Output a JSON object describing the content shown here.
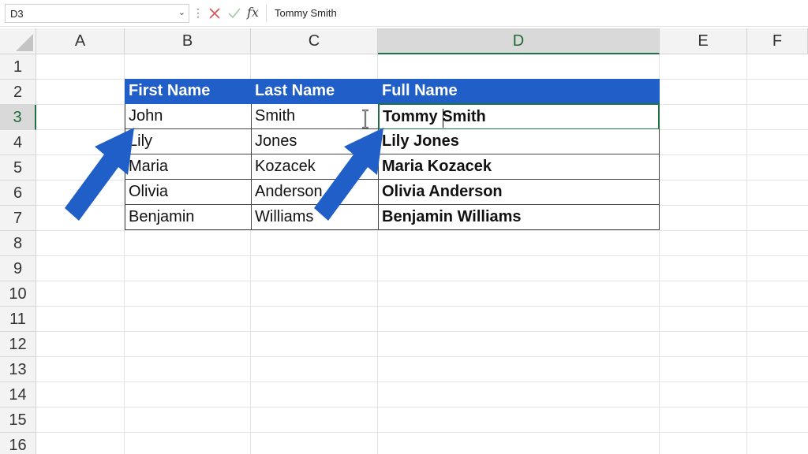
{
  "formula_bar": {
    "name_box": "D3",
    "formula": "Tommy Smith",
    "fx_label": "fx",
    "cancel_icon": "x-icon",
    "enter_icon": "check-icon"
  },
  "columns": [
    "A",
    "B",
    "C",
    "D",
    "E",
    "F"
  ],
  "rows": [
    "1",
    "2",
    "3",
    "4",
    "5",
    "6",
    "7",
    "8",
    "9",
    "10",
    "11",
    "12",
    "13",
    "14",
    "15",
    "16"
  ],
  "active_cell": {
    "column": "D",
    "row": "3"
  },
  "table": {
    "headers": [
      "First Name",
      "Last Name",
      "Full Name"
    ],
    "rows": [
      [
        "John",
        "Smith",
        "Tommy Smith"
      ],
      [
        "Lily",
        "Jones",
        "Lily  Jones"
      ],
      [
        "Maria",
        "Kozacek",
        "Maria Kozacek"
      ],
      [
        "Olivia",
        "Anderson",
        "Olivia  Anderson"
      ],
      [
        "Benjamin",
        "Williams",
        "Benjamin Williams"
      ]
    ],
    "header_color": "#1f5fc7"
  },
  "annotations": {
    "arrow_color": "#1f5fc7",
    "arrows": [
      "arrow-pointing-to-first-name",
      "arrow-pointing-to-full-name"
    ]
  }
}
